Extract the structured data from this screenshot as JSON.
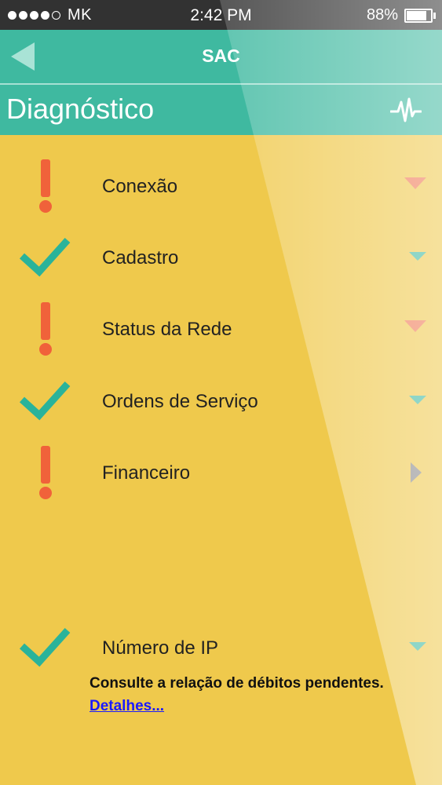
{
  "status_bar": {
    "carrier": "MK",
    "time": "2:42 PM",
    "battery": "88%",
    "battery_level": 0.88,
    "signal_dots_filled": 4,
    "signal_dots_total": 5
  },
  "header": {
    "title": "SAC",
    "back_icon": "back-arrow-icon"
  },
  "section": {
    "title": "Diagnóstico",
    "icon": "pulse-icon"
  },
  "items": [
    {
      "label": "Conexão",
      "status": "warning",
      "arrow": "down",
      "arrow_color": "#f07a55"
    },
    {
      "label": "Cadastro",
      "status": "ok",
      "arrow": "down",
      "arrow_color": "#3fb9a0"
    },
    {
      "label": "Status da Rede",
      "status": "warning",
      "arrow": "down",
      "arrow_color": "#f07a55"
    },
    {
      "label": "Ordens de Serviço",
      "status": "ok",
      "arrow": "down",
      "arrow_color": "#3fb9a0"
    },
    {
      "label": "Financeiro",
      "status": "warning",
      "arrow": "right",
      "arrow_color": "#8a8a8a"
    },
    {
      "label": "Número de IP",
      "status": "ok",
      "arrow": "down",
      "arrow_color": "#3fb9a0"
    }
  ],
  "financeiro_detail": {
    "message": "Consulte a relação de débitos pendentes.",
    "link": "Detalhes..."
  },
  "colors": {
    "header": "#3fb9a0",
    "background": "#efc94c",
    "warning": "#f0623a",
    "ok": "#2ab39a"
  }
}
